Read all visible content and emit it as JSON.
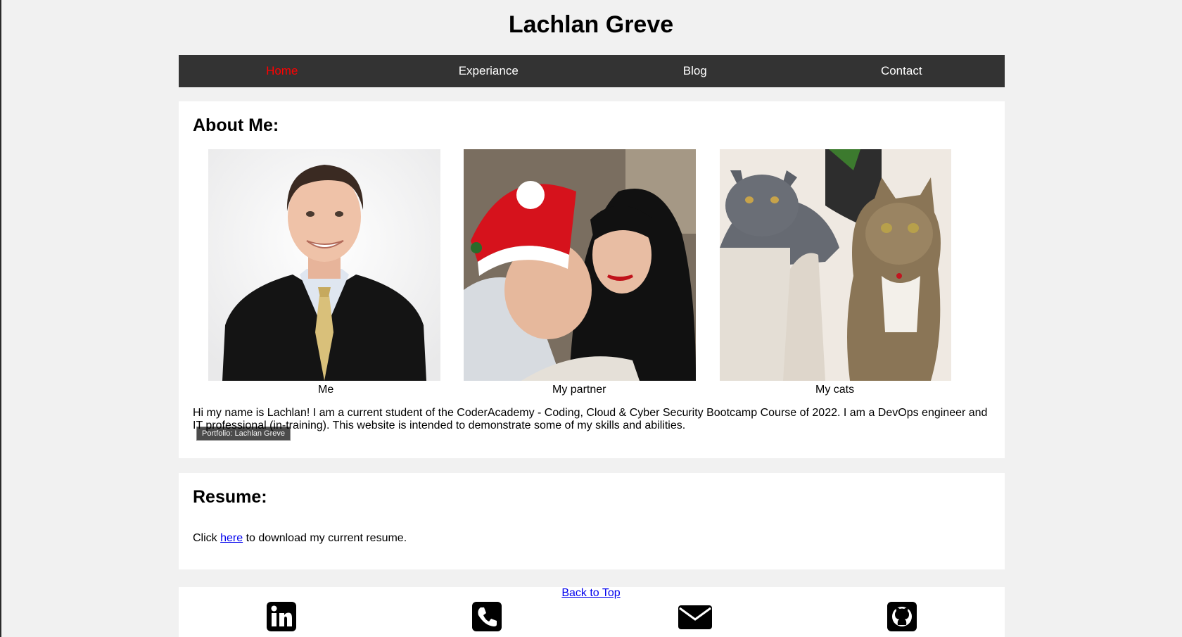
{
  "site": {
    "title": "Lachlan Greve"
  },
  "nav": {
    "items": [
      {
        "label": "Home",
        "active": true
      },
      {
        "label": "Experiance",
        "active": false
      },
      {
        "label": "Blog",
        "active": false
      },
      {
        "label": "Contact",
        "active": false
      }
    ],
    "background": "#333333",
    "active_color": "#ff0000"
  },
  "about": {
    "heading": "About Me:",
    "photos": [
      {
        "caption": "Me",
        "tooltip": "Portfolio: Lachlan Greve"
      },
      {
        "caption": "My partner"
      },
      {
        "caption": "My cats"
      }
    ],
    "text": "Hi my name is Lachlan! I am a current student of the CoderAcademy - Coding, Cloud & Cyber Security Bootcamp Course of 2022. I am a DevOps engineer and IT professional (in-training). This website is intended to demonstrate some of my skills and abilities."
  },
  "resume": {
    "heading": "Resume:",
    "text_before": "Click ",
    "link_label": "here",
    "text_after": " to download my current resume."
  },
  "footer": {
    "back_to_top": "Back to Top",
    "icons": [
      "linkedin-icon",
      "phone-icon",
      "email-icon",
      "github-icon"
    ]
  }
}
